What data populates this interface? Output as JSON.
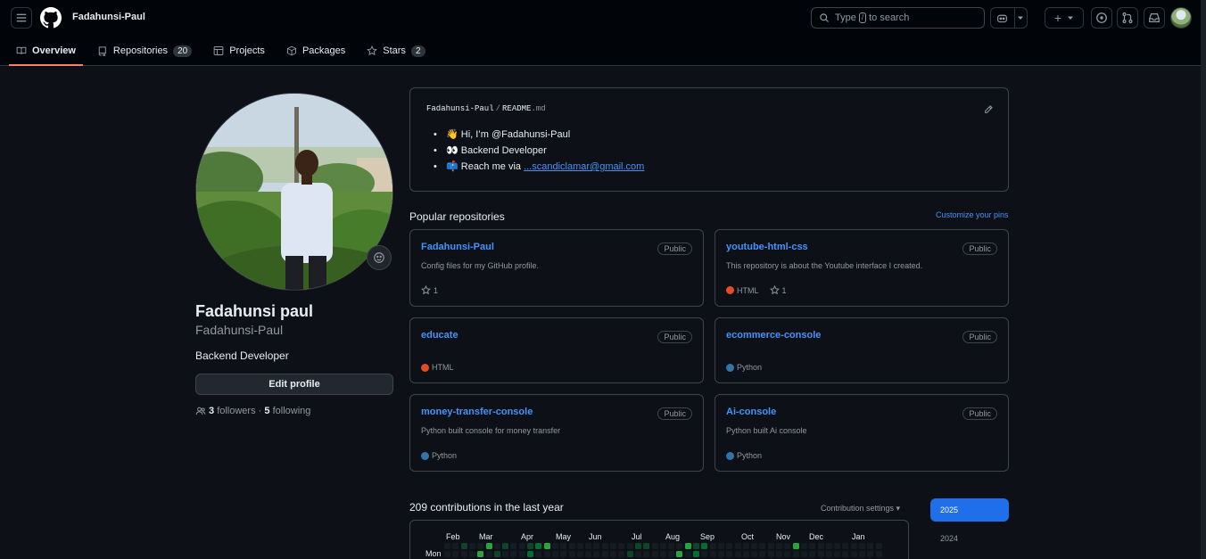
{
  "header": {
    "username": "Fadahunsi-Paul",
    "search": {
      "prefix": "Type",
      "key": "/",
      "suffix": "to search"
    },
    "new_button": "+"
  },
  "tabs": [
    {
      "label": "Overview",
      "icon": "book-icon"
    },
    {
      "label": "Repositories",
      "icon": "repo-icon",
      "count": "20"
    },
    {
      "label": "Projects",
      "icon": "table-icon"
    },
    {
      "label": "Packages",
      "icon": "package-icon"
    },
    {
      "label": "Stars",
      "icon": "star-icon",
      "count": "2"
    }
  ],
  "profile": {
    "full_name": "Fadahunsi paul",
    "login": "Fadahunsi-Paul",
    "bio": "Backend Developer",
    "edit_label": "Edit profile",
    "followers_count": "3",
    "followers_label": "followers",
    "separator": "·",
    "following_count": "5",
    "following_label": "following"
  },
  "readme": {
    "owner": "Fadahunsi-Paul",
    "sep": "/",
    "file": "README",
    "ext": ".md",
    "items": [
      {
        "text": "👋 Hi, I’m @Fadahunsi-Paul"
      },
      {
        "text": "👀 Backend Developer"
      },
      {
        "text": "📫 Reach me via ",
        "link": "...scandiclamar@gmail.com"
      }
    ]
  },
  "popular": {
    "title": "Popular repositories",
    "customize": "Customize your pins",
    "repos": [
      {
        "name": "Fadahunsi-Paul",
        "visibility": "Public",
        "description": "Config files for my GitHub profile.",
        "language": "",
        "lang_color": "",
        "stars": "1"
      },
      {
        "name": "youtube-html-css",
        "visibility": "Public",
        "description": "This repository is about the Youtube interface I created.",
        "language": "HTML",
        "lang_color": "#e34c26",
        "stars": "1"
      },
      {
        "name": "educate",
        "visibility": "Public",
        "description": "",
        "language": "HTML",
        "lang_color": "#e34c26",
        "stars": ""
      },
      {
        "name": "ecommerce-console",
        "visibility": "Public",
        "description": "",
        "language": "Python",
        "lang_color": "#3572A5",
        "stars": ""
      },
      {
        "name": "money-transfer-console",
        "visibility": "Public",
        "description": "Python built console for money transfer",
        "language": "Python",
        "lang_color": "#3572A5",
        "stars": ""
      },
      {
        "name": "Ai-console",
        "visibility": "Public",
        "description": "Python built Ai console",
        "language": "Python",
        "lang_color": "#3572A5",
        "stars": ""
      }
    ]
  },
  "contributions": {
    "title": "209 contributions in the last year",
    "settings": "Contribution settings ▾",
    "months": [
      "Feb",
      "Mar",
      "Apr",
      "May",
      "Jun",
      "Jul",
      "Aug",
      "Sep",
      "Oct",
      "Nov",
      "Dec",
      "Jan"
    ],
    "day_label": "Mon",
    "years": [
      "2025",
      "2024"
    ]
  }
}
